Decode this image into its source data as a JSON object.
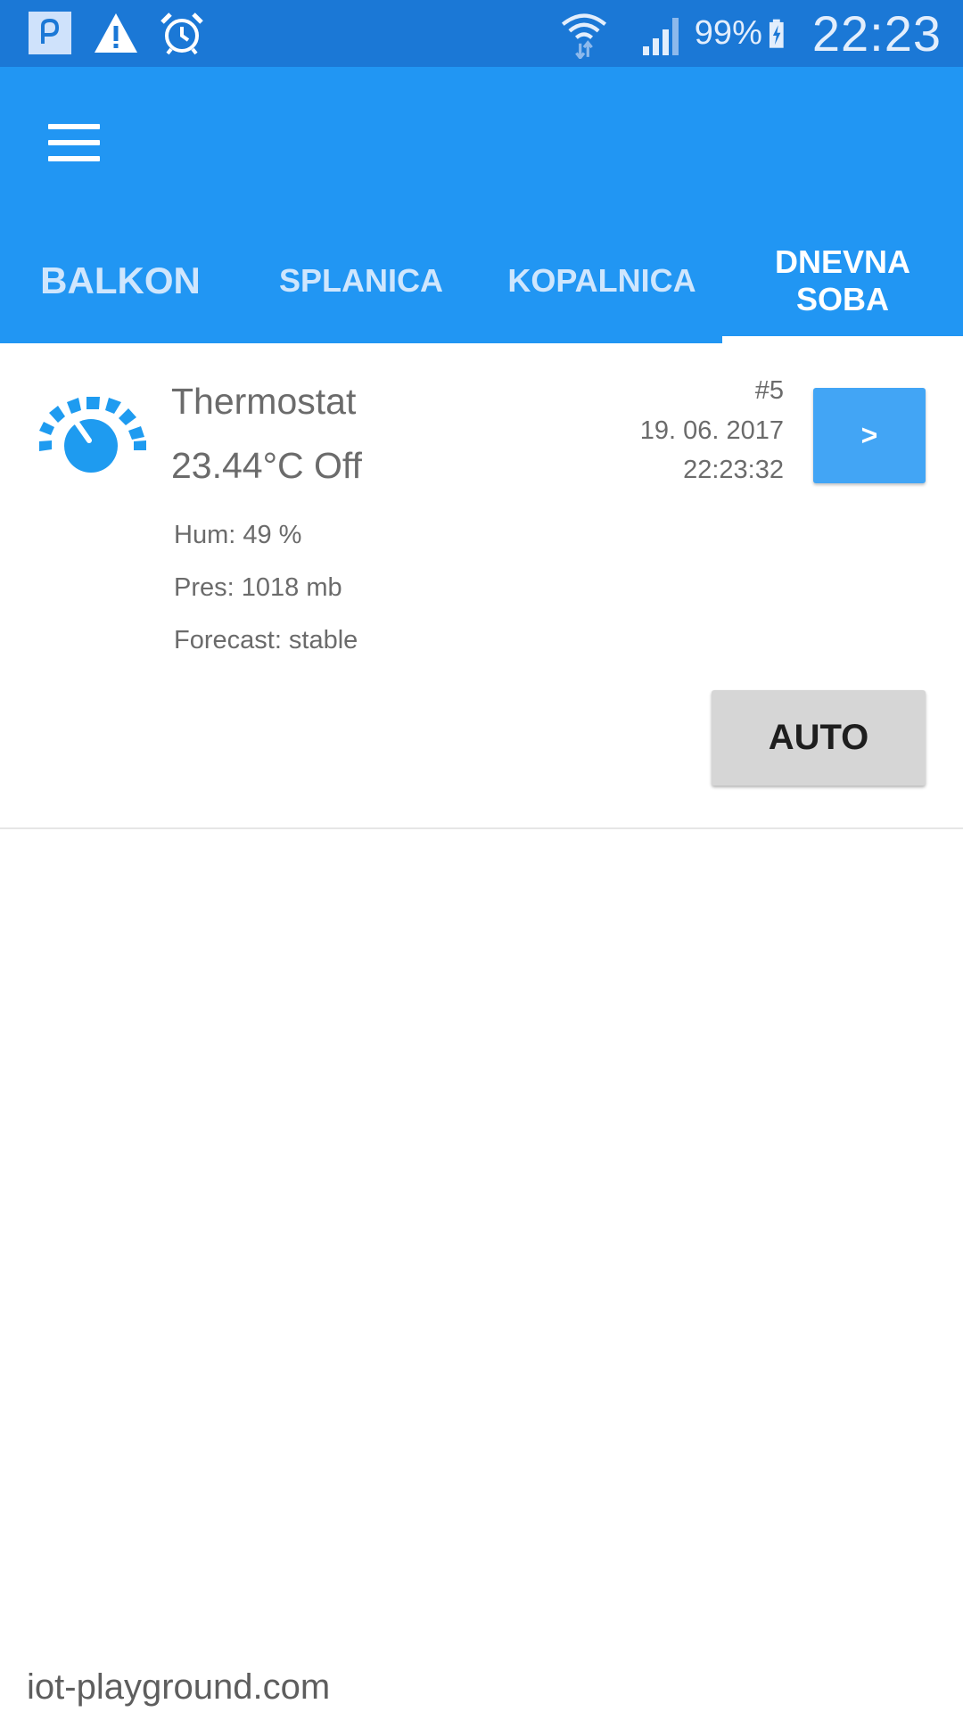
{
  "status_bar": {
    "left_icons": [
      "app-notification-icon",
      "warning-icon",
      "alarm-clock-icon"
    ],
    "right_icons": [
      "wifi-icon",
      "cell-signal-icon",
      "battery-charging-icon"
    ],
    "battery_percent": "99%",
    "time": "22:23",
    "background": "#1b78d6"
  },
  "app_bar": {
    "background": "#2196f3",
    "menu_icon": "hamburger-menu-icon",
    "tabs": [
      {
        "label": "BALKON",
        "active": false
      },
      {
        "label": "SPLANICA",
        "active": false
      },
      {
        "label": "KOPALNICA",
        "active": false
      },
      {
        "label": "DNEVNA SOBA",
        "active": true
      }
    ]
  },
  "card": {
    "icon": "thermostat-dial-icon",
    "icon_color": "#1e9bf0",
    "title": "Thermostat",
    "temperature_state": "23.44°C Off",
    "humidity": "Hum: 49 %",
    "pressure": "Pres: 1018 mb",
    "forecast": "Forecast: stable",
    "node_id": "#5",
    "date": "19. 06. 2017",
    "time": "22:23:32",
    "next_button_label": ">",
    "auto_button_label": "AUTO"
  },
  "footer": {
    "text": "iot-playground.com"
  }
}
